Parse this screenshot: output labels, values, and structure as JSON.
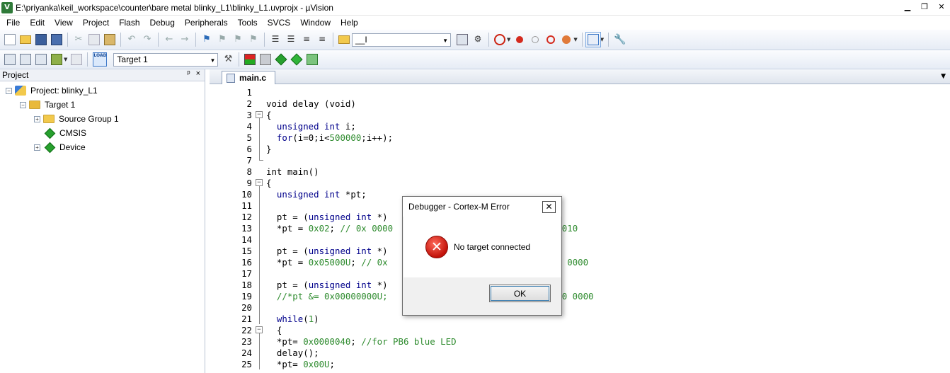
{
  "window": {
    "title": "E:\\priyanka\\keil_workspace\\counter\\bare metal blinky_L1\\blinky_L1.uvprojx - µVision",
    "app_icon": "V"
  },
  "menu": [
    "File",
    "Edit",
    "View",
    "Project",
    "Flash",
    "Debug",
    "Peripherals",
    "Tools",
    "SVCS",
    "Window",
    "Help"
  ],
  "toolbar": {
    "find_value": "__I",
    "target_value": "Target 1",
    "load_label": "LOAD"
  },
  "project_panel": {
    "title": "Project",
    "pin": "ᵖ",
    "close": "×",
    "tree": [
      {
        "label": "Project: blinky_L1",
        "level": 0,
        "icon": "project-icon",
        "expand": "−"
      },
      {
        "label": "Target 1",
        "level": 1,
        "icon": "target-folder-icon",
        "expand": "−"
      },
      {
        "label": "Source Group 1",
        "level": 2,
        "icon": "folder-icon",
        "expand": "+"
      },
      {
        "label": "CMSIS",
        "level": 2,
        "icon": "component-diamond-icon",
        "expand": ""
      },
      {
        "label": "Device",
        "level": 2,
        "icon": "component-diamond-icon",
        "expand": "+"
      }
    ]
  },
  "editor": {
    "tab": "main.c",
    "lines": [
      {
        "n": "1",
        "fold": "",
        "segs": []
      },
      {
        "n": "2",
        "fold": "",
        "segs": [
          {
            "t": "void delay (void)",
            "c": "ct"
          }
        ]
      },
      {
        "n": "3",
        "fold": "box",
        "segs": [
          {
            "t": "{",
            "c": "ct"
          }
        ]
      },
      {
        "n": "4",
        "fold": "line",
        "segs": [
          {
            "t": "  ",
            "c": "ct"
          },
          {
            "t": "unsigned int",
            "c": "kw"
          },
          {
            "t": " i;",
            "c": "ct"
          }
        ]
      },
      {
        "n": "5",
        "fold": "line",
        "segs": [
          {
            "t": "  ",
            "c": "ct"
          },
          {
            "t": "for",
            "c": "kw"
          },
          {
            "t": "(i=0;i<",
            "c": "ct"
          },
          {
            "t": "500000",
            "c": "lt"
          },
          {
            "t": ";i++);",
            "c": "ct"
          }
        ]
      },
      {
        "n": "6",
        "fold": "line",
        "segs": [
          {
            "t": "}",
            "c": "ct"
          }
        ]
      },
      {
        "n": "7",
        "fold": "end",
        "segs": []
      },
      {
        "n": "8",
        "fold": "",
        "segs": [
          {
            "t": "int main()",
            "c": "ct"
          }
        ]
      },
      {
        "n": "9",
        "fold": "box",
        "segs": [
          {
            "t": "{",
            "c": "ct"
          }
        ]
      },
      {
        "n": "10",
        "fold": "line",
        "segs": [
          {
            "t": "  ",
            "c": "ct"
          },
          {
            "t": "unsigned int",
            "c": "kw"
          },
          {
            "t": " *pt;",
            "c": "ct"
          }
        ]
      },
      {
        "n": "11",
        "fold": "line",
        "segs": []
      },
      {
        "n": "12",
        "fold": "line",
        "segs": [
          {
            "t": "  pt = (",
            "c": "ct"
          },
          {
            "t": "unsigned int",
            "c": "kw"
          },
          {
            "t": " *)",
            "c": "ct"
          }
        ]
      },
      {
        "n": "13",
        "fold": "line",
        "segs": [
          {
            "t": "  *pt = ",
            "c": "ct"
          },
          {
            "t": "0x02",
            "c": "lt"
          },
          {
            "t": "; ",
            "c": "ct"
          },
          {
            "t": "// 0x 0000",
            "c": "cm"
          },
          {
            "t": "                            ",
            "c": "ct"
          },
          {
            "t": "00 0010",
            "c": "cm"
          }
        ]
      },
      {
        "n": "14",
        "fold": "line",
        "segs": []
      },
      {
        "n": "15",
        "fold": "line",
        "segs": [
          {
            "t": "  pt = (",
            "c": "ct"
          },
          {
            "t": "unsigned int",
            "c": "kw"
          },
          {
            "t": " *)",
            "c": "ct"
          }
        ]
      },
      {
        "n": "16",
        "fold": "line",
        "segs": [
          {
            "t": "  *pt = ",
            "c": "ct"
          },
          {
            "t": "0x05000U",
            "c": "lt"
          },
          {
            "t": "; ",
            "c": "ct"
          },
          {
            "t": "// 0x",
            "c": "cm"
          },
          {
            "t": "                           ",
            "c": "ct"
          },
          {
            "t": "0 0000 0000",
            "c": "cm"
          }
        ]
      },
      {
        "n": "17",
        "fold": "line",
        "segs": []
      },
      {
        "n": "18",
        "fold": "line",
        "segs": [
          {
            "t": "  pt = (",
            "c": "ct"
          },
          {
            "t": "unsigned int",
            "c": "kw"
          },
          {
            "t": " *)",
            "c": "ct"
          }
        ]
      },
      {
        "n": "19",
        "fold": "line",
        "segs": [
          {
            "t": "  ",
            "c": "ct"
          },
          {
            "t": "//*pt &= 0x00000000U;",
            "c": "cm"
          },
          {
            "t": "                      ",
            "c": "ct"
          },
          {
            "t": "00 0000 0000 0000",
            "c": "cm"
          }
        ]
      },
      {
        "n": "20",
        "fold": "line",
        "segs": []
      },
      {
        "n": "21",
        "fold": "line",
        "segs": [
          {
            "t": "  ",
            "c": "ct"
          },
          {
            "t": "while",
            "c": "kw"
          },
          {
            "t": "(",
            "c": "ct"
          },
          {
            "t": "1",
            "c": "lt"
          },
          {
            "t": ")",
            "c": "ct"
          }
        ]
      },
      {
        "n": "22",
        "fold": "box",
        "segs": [
          {
            "t": "  {",
            "c": "ct"
          }
        ]
      },
      {
        "n": "23",
        "fold": "line",
        "segs": [
          {
            "t": "  *pt= ",
            "c": "ct"
          },
          {
            "t": "0x0000040",
            "c": "lt"
          },
          {
            "t": "; ",
            "c": "ct"
          },
          {
            "t": "//for PB6 blue LED",
            "c": "cm"
          }
        ]
      },
      {
        "n": "24",
        "fold": "line",
        "segs": [
          {
            "t": "  delay();",
            "c": "ct"
          }
        ]
      },
      {
        "n": "25",
        "fold": "line",
        "segs": [
          {
            "t": "  *pt= ",
            "c": "ct"
          },
          {
            "t": "0x00U",
            "c": "lt"
          },
          {
            "t": ";",
            "c": "ct"
          }
        ]
      }
    ]
  },
  "dialog": {
    "title": "Debugger - Cortex-M Error",
    "close": "✕",
    "icon": "error-icon",
    "message": "No target connected",
    "ok_label": "OK"
  },
  "colors": {
    "keyword": "#00008b",
    "comment": "#2e8b2e",
    "error_red": "#c2120a"
  }
}
